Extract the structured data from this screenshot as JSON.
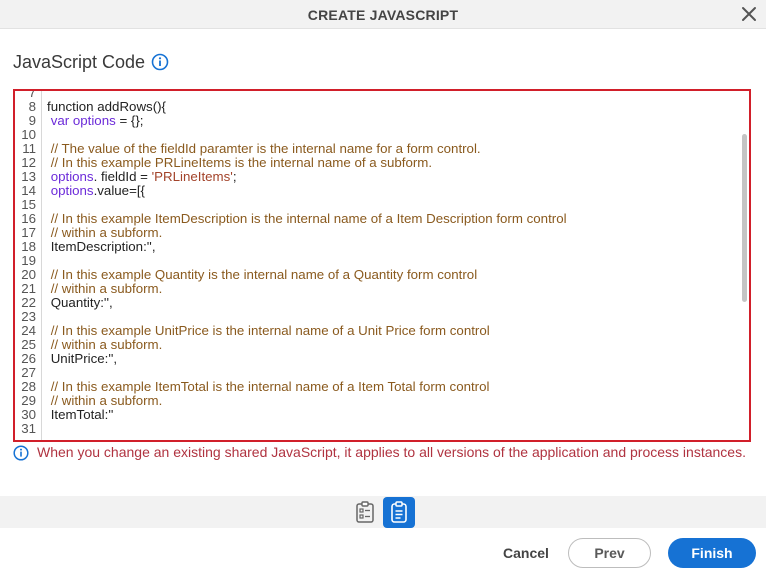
{
  "dialog": {
    "title": "CREATE JAVASCRIPT"
  },
  "section": {
    "title": "JavaScript Code"
  },
  "editor": {
    "lines": [
      {
        "n": "7",
        "html": ""
      },
      {
        "n": "8",
        "html": "function addRows(){"
      },
      {
        "n": "9",
        "html": " <span class=\"kw\">var options</span> = {};"
      },
      {
        "n": "10",
        "html": ""
      },
      {
        "n": "11",
        "html": " <span class=\"cm\">// The value of the fieldId paramter is the internal name for a form control.</span>"
      },
      {
        "n": "12",
        "html": " <span class=\"cm\">// In this example PRLineItems is the internal name of a subform.</span>"
      },
      {
        "n": "13",
        "html": " <span class=\"kw\">options</span>. fieldId = <span class=\"str\">'PRLineItems'</span>;"
      },
      {
        "n": "14",
        "html": " <span class=\"kw\">options</span>.value=[{"
      },
      {
        "n": "15",
        "html": ""
      },
      {
        "n": "16",
        "html": " <span class=\"cm\">// In this example ItemDescription is the internal name of a Item Description form control</span>"
      },
      {
        "n": "17",
        "html": " <span class=\"cm\">// within a subform.</span>"
      },
      {
        "n": "18",
        "html": " ItemDescription:'',"
      },
      {
        "n": "19",
        "html": ""
      },
      {
        "n": "20",
        "html": " <span class=\"cm\">// In this example Quantity is the internal name of a Quantity form control</span>"
      },
      {
        "n": "21",
        "html": " <span class=\"cm\">// within a subform.</span>"
      },
      {
        "n": "22",
        "html": " Quantity:'',"
      },
      {
        "n": "23",
        "html": ""
      },
      {
        "n": "24",
        "html": " <span class=\"cm\">// In this example UnitPrice is the internal name of a Unit Price form control</span>"
      },
      {
        "n": "25",
        "html": " <span class=\"cm\">// within a subform.</span>"
      },
      {
        "n": "26",
        "html": " UnitPrice:'',"
      },
      {
        "n": "27",
        "html": ""
      },
      {
        "n": "28",
        "html": " <span class=\"cm\">// In this example ItemTotal is the internal name of a Item Total form control</span>"
      },
      {
        "n": "29",
        "html": " <span class=\"cm\">// within a subform.</span>"
      },
      {
        "n": "30",
        "html": " ItemTotal:''"
      },
      {
        "n": "31",
        "html": ""
      }
    ]
  },
  "notice": {
    "text": "When you change an existing shared JavaScript, it applies to all versions of the application and process instances."
  },
  "footer": {
    "cancel_label": "Cancel",
    "prev_label": "Prev",
    "finish_label": "Finish"
  },
  "icons": {
    "close": "close-icon",
    "info": "info-icon",
    "form_view": "form-view-icon",
    "clipboard": "clipboard-icon"
  },
  "colors": {
    "accent": "#1672d4",
    "editor_border": "#d11f2a",
    "notice_text": "#b03340"
  }
}
